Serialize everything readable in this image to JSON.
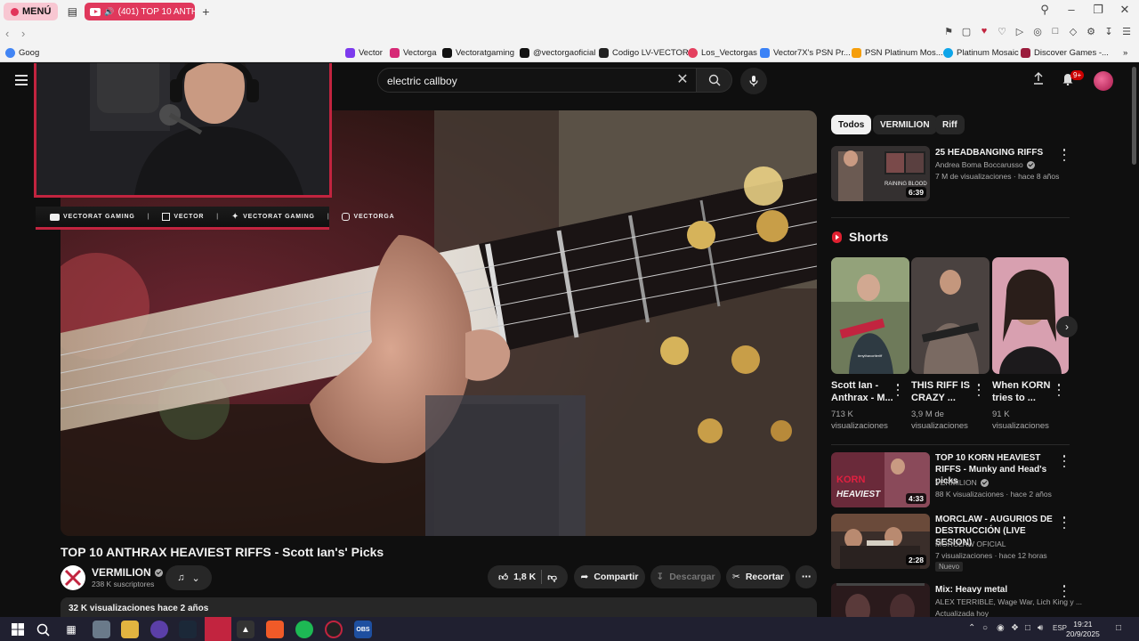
{
  "browser": {
    "menu_label": "MENÚ",
    "active_tab_title": "(401) TOP 10 ANTHRA",
    "url_partial": "",
    "bookmarks": [
      {
        "label": "Goog",
        "color": "#4285f4"
      },
      {
        "label": "Vector",
        "color": "#7c3aed"
      },
      {
        "label": "Vectorga",
        "color": "#d62976"
      },
      {
        "label": "Vectoratgaming",
        "color": "#111111"
      },
      {
        "label": "@vectorgaoficial",
        "color": "#111111"
      },
      {
        "label": "Codigo LV-VECTOR",
        "color": "#222222"
      },
      {
        "label": "Los_Vectorgas",
        "color": "#e4405f"
      },
      {
        "label": "Vector7X's PSN Pr...",
        "color": "#3b82f6"
      },
      {
        "label": "PSN Platinum Mos...",
        "color": "#f59e0b"
      },
      {
        "label": "Platinum Mosaic",
        "color": "#0ea5e9"
      },
      {
        "label": "Discover Games -...",
        "color": "#9b1c3c"
      }
    ]
  },
  "youtube": {
    "search_value": "electric callboy",
    "notifications_badge": "9+",
    "video": {
      "title": "TOP 10 ANTHRAX HEAVIEST RIFFS - Scott Ian's' Picks",
      "channel": "VERMILION",
      "subscribers": "238 K suscriptores",
      "likes": "1,8 K",
      "share_label": "Compartir",
      "download_label": "Descargar",
      "clip_label": "Recortar",
      "views_date": "32 K visualizaciones  hace 2 años"
    },
    "overlay": {
      "items": [
        {
          "icon": "youtube-icon",
          "label": "VECTORAT GAMING"
        },
        {
          "icon": "twitch-icon",
          "label": "VECTOR"
        },
        {
          "icon": "twitter-icon",
          "label": "VECTORAT GAMING"
        },
        {
          "icon": "instagram-icon",
          "label": "VECTORGA"
        }
      ]
    },
    "chips": [
      "Todos",
      "VERMILION",
      "Riff"
    ],
    "shorts_label": "Shorts",
    "recommendations": [
      {
        "title": "25 HEADBANGING RIFFS",
        "channel": "Andrea Boma Boccarusso",
        "meta": "7 M de visualizaciones · hace 8 años",
        "duration": "6:39",
        "badge": ""
      },
      {
        "title": "TOP 10 KORN HEAVIEST RIFFS - Munky and Head's picks",
        "channel": "VERMILION",
        "meta": "88 K visualizaciones · hace 2 años",
        "duration": "4:33",
        "badge": ""
      },
      {
        "title": "MORCLAW - AUGURIOS DE DESTRUCCIÓN (LIVE SESION)",
        "channel": "MORCLAW OFICIAL",
        "meta": "7 visualizaciones · hace 12 horas",
        "duration": "2:28",
        "badge": "Nuevo"
      },
      {
        "title": "Mix: Heavy metal",
        "channel": "ALEX TERRIBLE, Wage War, Lich King y ...",
        "meta": "Actualizada hoy",
        "duration": "",
        "badge": ""
      }
    ],
    "shorts": [
      {
        "title": "Scott Ian - Anthrax - M...",
        "views": "713 K visualizaciones"
      },
      {
        "title": "THIS RIFF IS CRAZY ...",
        "views": "3,9 M de visualizaciones"
      },
      {
        "title": "When KORN tries to ...",
        "views": "91 K visualizaciones"
      }
    ]
  },
  "taskbar": {
    "lang": "ESP",
    "time": "19:21",
    "date": "20/9/2025"
  }
}
